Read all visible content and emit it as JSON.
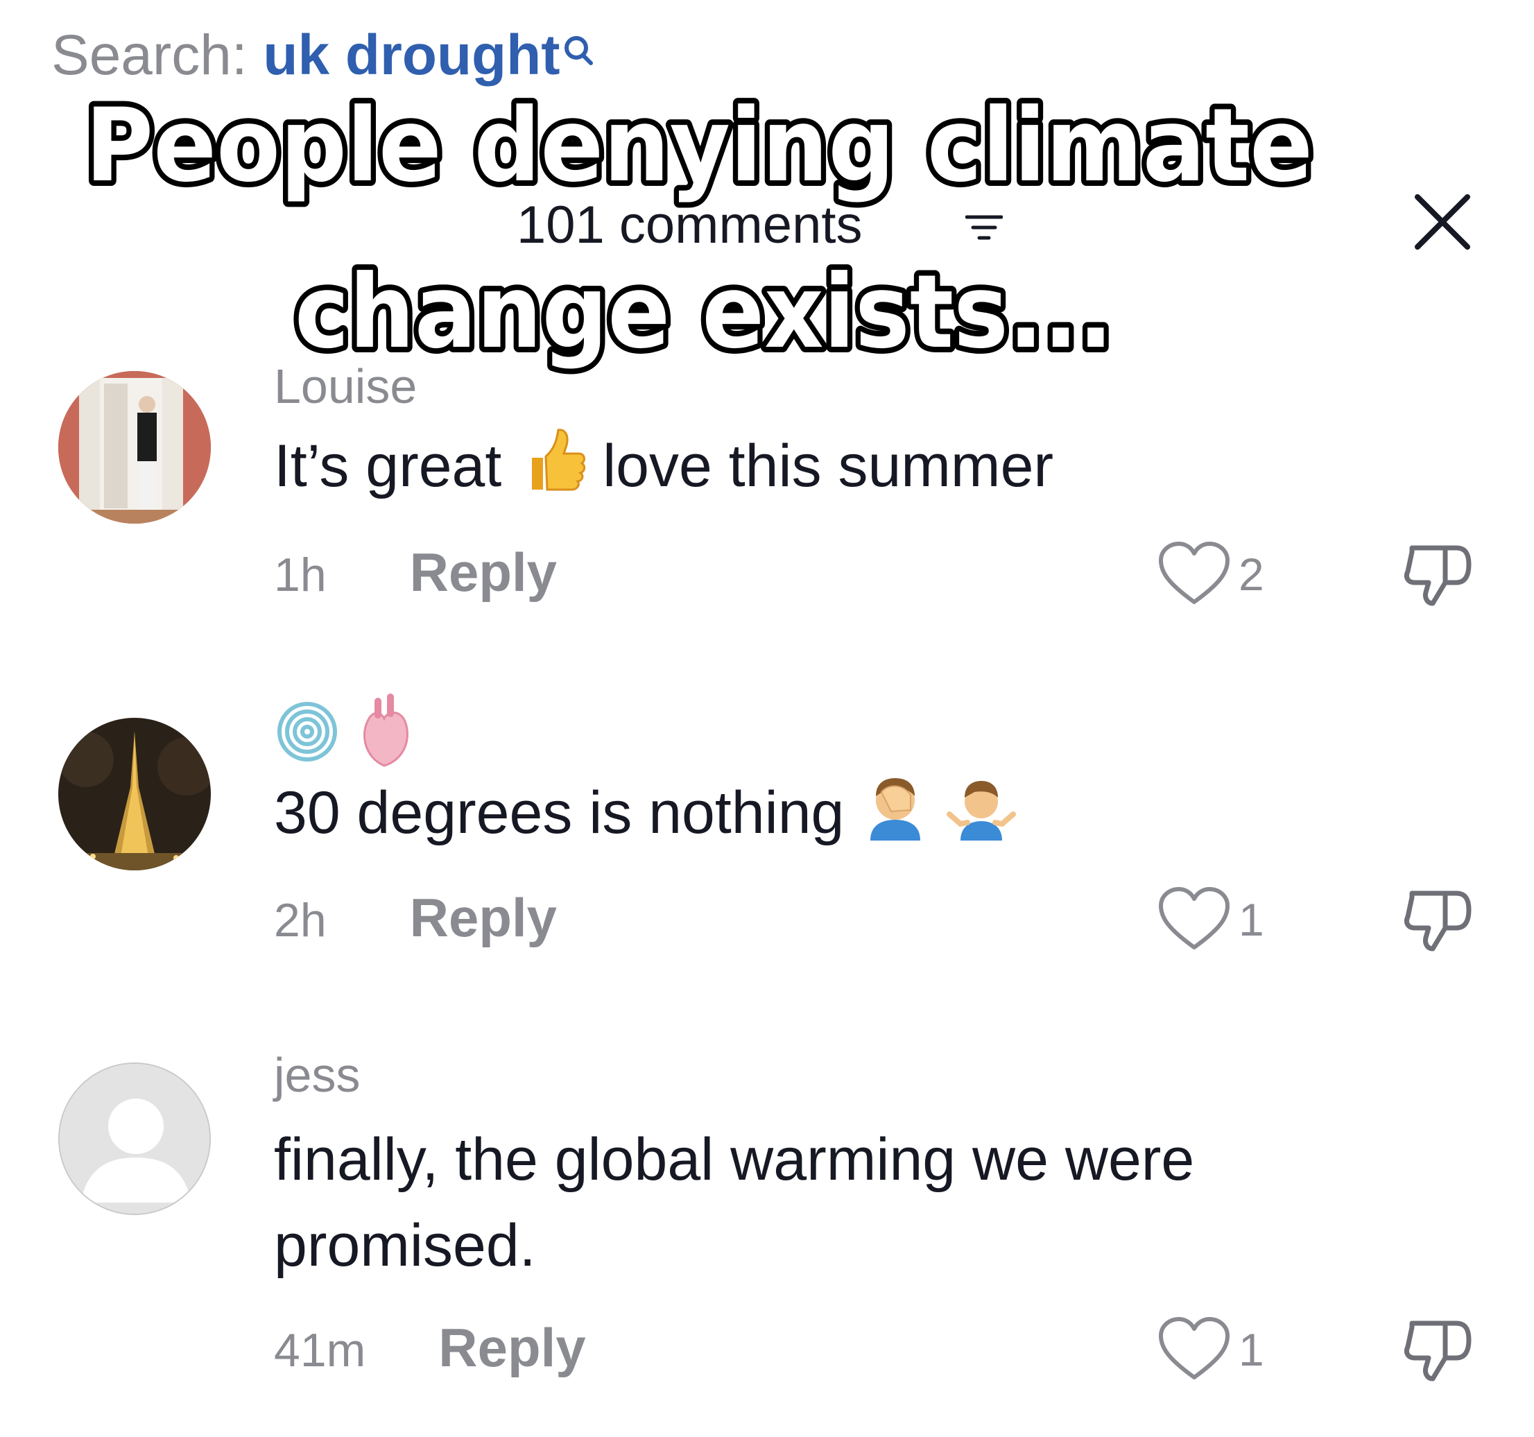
{
  "search": {
    "prefix": "Search:",
    "query": "uk drought",
    "icon": "search-icon"
  },
  "overlay": {
    "line1": "People denying climate",
    "line2": "change exists..."
  },
  "header": {
    "comments_count": "101 comments",
    "filter_icon": "filter-icon",
    "close_icon": "close-icon"
  },
  "colors": {
    "search_query": "#2f5fae",
    "secondary_text": "#8a8b91",
    "primary_text": "#161823"
  },
  "comments": [
    {
      "username": "Louise",
      "text_before": "It’s great",
      "emoji": "thumbs-up-emoji",
      "text_after": "love this summer",
      "time": "1h",
      "reply_label": "Reply",
      "likes": "2",
      "avatar": "photo-avatar-doorway"
    },
    {
      "username_icons": [
        "fingerprint-emoji",
        "anatomical-heart-emoji"
      ],
      "text": "30 degrees is nothing",
      "emojis": [
        "facepalm-emoji",
        "shrug-emoji"
      ],
      "time": "2h",
      "reply_label": "Reply",
      "likes": "1",
      "avatar": "photo-avatar-eiffel-tower"
    },
    {
      "username": "jess",
      "text": "finally, the global warming we were promised.",
      "time": "41m",
      "reply_label": "Reply",
      "likes": "1",
      "avatar": "default-avatar"
    }
  ]
}
